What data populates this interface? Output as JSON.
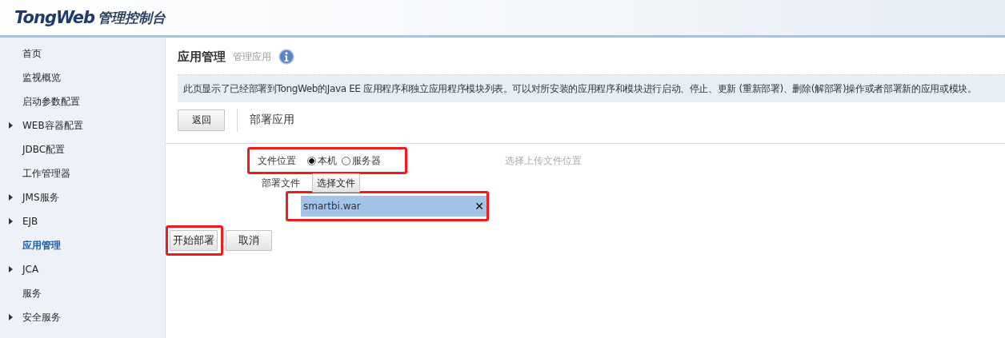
{
  "header": {
    "logo": "TongWeb",
    "title": "管理控制台"
  },
  "sidebar": {
    "items": [
      {
        "label": "首页",
        "expandable": false,
        "selected": false
      },
      {
        "label": "监视概览",
        "expandable": false,
        "selected": false
      },
      {
        "label": "启动参数配置",
        "expandable": false,
        "selected": false
      },
      {
        "label": "WEB容器配置",
        "expandable": true,
        "selected": false
      },
      {
        "label": "JDBC配置",
        "expandable": false,
        "selected": false
      },
      {
        "label": "工作管理器",
        "expandable": false,
        "selected": false
      },
      {
        "label": "JMS服务",
        "expandable": true,
        "selected": false
      },
      {
        "label": "EJB",
        "expandable": true,
        "selected": false
      },
      {
        "label": "应用管理",
        "expandable": false,
        "selected": true
      },
      {
        "label": "JCA",
        "expandable": true,
        "selected": false
      },
      {
        "label": "服务",
        "expandable": false,
        "selected": false
      },
      {
        "label": "安全服务",
        "expandable": true,
        "selected": false
      }
    ]
  },
  "page": {
    "title": "应用管理",
    "subtitle": "管理应用",
    "description": "此页显示了已经部署到TongWeb的Java EE 应用程序和独立应用程序模块列表。可以对所安装的应用程序和模块进行启动、停止、更新 (重新部署)、删除(解部署)操作或者部署新的应用或模块。"
  },
  "toolbar": {
    "back_button": "返回",
    "section_title": "部署应用"
  },
  "form": {
    "file_location": {
      "label": "文件位置",
      "highlighted": true,
      "options": [
        {
          "label": "本机",
          "selected": true
        },
        {
          "label": "服务器",
          "selected": false
        }
      ],
      "hint": "选择上传文件位置"
    },
    "deploy_file": {
      "label": "部署文件",
      "choose_button": "选择文件",
      "file": {
        "name": "smartbi.war",
        "remove": "✕",
        "highlighted": true
      }
    }
  },
  "actions": [
    {
      "label": "开始部署",
      "highlighted": true
    },
    {
      "label": "取消",
      "highlighted": false
    }
  ]
}
